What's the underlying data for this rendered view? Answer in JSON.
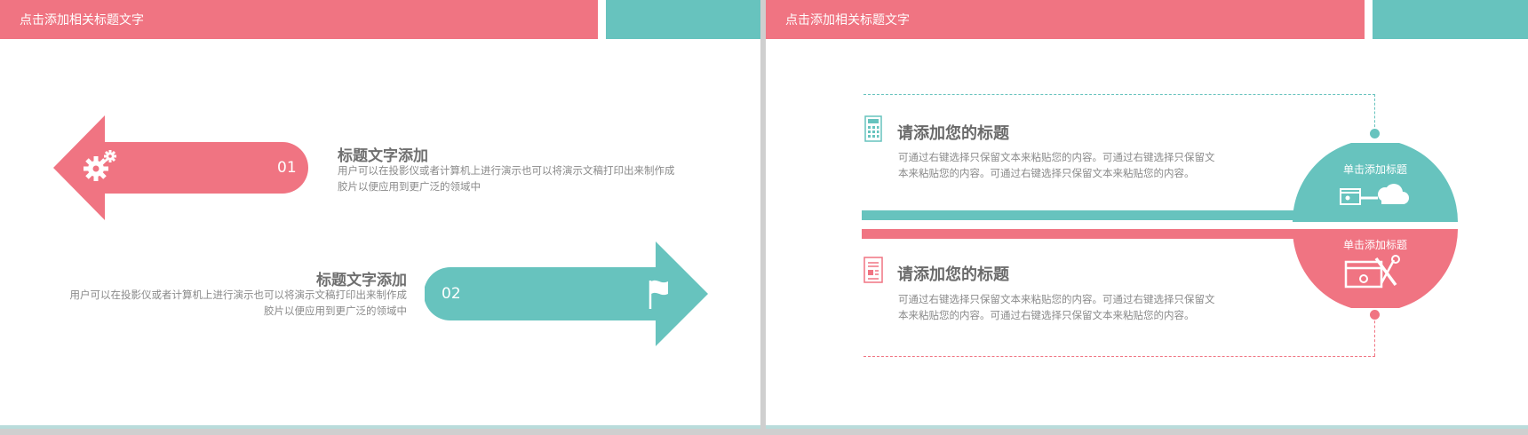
{
  "colors": {
    "pink": "#f07482",
    "teal": "#67c3be",
    "text": "#6f6f6f"
  },
  "left_slide": {
    "header_title": "点击添加相关标题文字",
    "item1": {
      "number": "01",
      "title": "标题文字添加",
      "desc_line1": "用户可以在投影仪或者计算机上进行演示也可以将演示文稿打印出来制作成",
      "desc_line2": "胶片以便应用到更广泛的领域中",
      "icon": "gears-icon"
    },
    "item2": {
      "number": "02",
      "title": "标题文字添加",
      "desc_line1": "用户可以在投影仪或者计算机上进行演示也可以将演示文稿打印出来制作成",
      "desc_line2": "胶片以便应用到更广泛的领域中",
      "icon": "flag-icon"
    }
  },
  "right_slide": {
    "header_title": "点击添加相关标题文字",
    "top_item": {
      "title": "请添加您的标题",
      "desc_line1": "可通过右键选择只保留文本来粘贴您的内容。可通过右键选择只保留文",
      "desc_line2": "本来粘贴您的内容。可通过右键选择只保留文本来粘贴您的内容。",
      "icon": "calculator-icon"
    },
    "bottom_item": {
      "title": "请添加您的标题",
      "desc_line1": "可通过右键选择只保留文本来粘贴您的内容。可通过右键选择只保留文",
      "desc_line2": "本来粘贴您的内容。可通过右键选择只保留文本来粘贴您的内容。",
      "icon": "document-icon"
    },
    "circle_top_label": "单击添加标题",
    "circle_bottom_label": "单击添加标题",
    "circle_top_icon": "cloud-transfer-icon",
    "circle_bottom_icon": "browser-tools-icon"
  }
}
